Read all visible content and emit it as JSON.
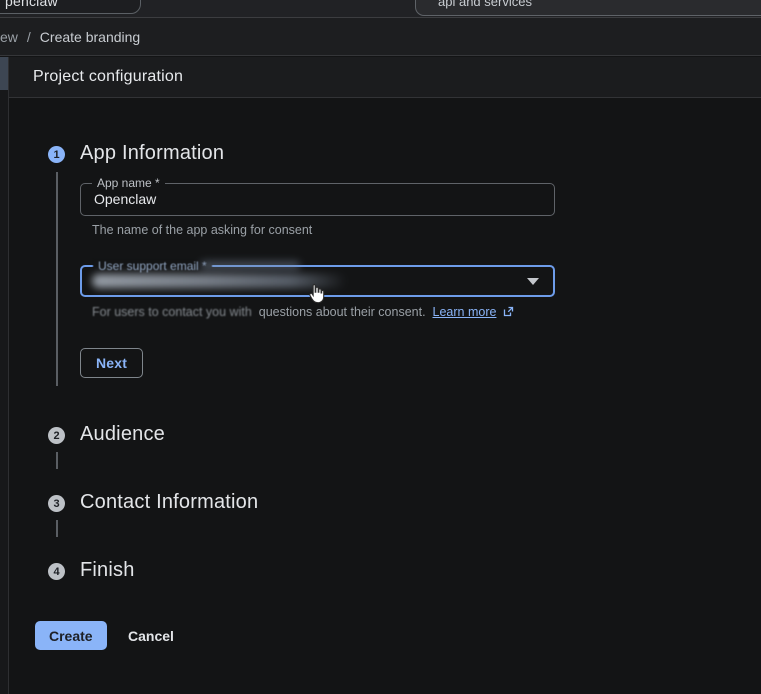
{
  "colors": {
    "accent_blue": "#8ab4f8",
    "focus_border_blue": "#6d9cea",
    "step_inactive_gray": "#bdc1c6",
    "text_primary": "#e8eaed",
    "text_secondary": "#9aa0a6",
    "outline_gray": "#5f6368",
    "content_background": "#131415"
  },
  "top_bar": {
    "tab_label": "penclaw",
    "search_label": "api and services"
  },
  "breadcrumb": {
    "prefix": "ew",
    "separator": "/",
    "current": "Create branding"
  },
  "panel": {
    "title": "Project configuration"
  },
  "stepper": {
    "steps": [
      {
        "number": "1",
        "label": "App Information",
        "state": "active"
      },
      {
        "number": "2",
        "label": "Audience",
        "state": "inactive"
      },
      {
        "number": "3",
        "label": "Contact Information",
        "state": "inactive"
      },
      {
        "number": "4",
        "label": "Finish",
        "state": "inactive"
      }
    ]
  },
  "form": {
    "app_name": {
      "label": "App name *",
      "value": "Openclaw",
      "helper": "The name of the app asking for consent"
    },
    "support_email": {
      "label": "User support email *",
      "value_state": "redacted-blurred",
      "helper_prefix": "For users to contact you with",
      "helper_rest": "questions about their consent.",
      "learn_more_label": "Learn more"
    },
    "next_label": "Next"
  },
  "footer_actions": {
    "create_label": "Create",
    "cancel_label": "Cancel"
  }
}
